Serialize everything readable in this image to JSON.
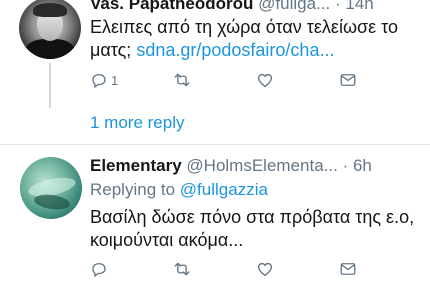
{
  "tweets": [
    {
      "display_name": "Vas. Papatheodorou",
      "handle": "@fullga...",
      "separator": "·",
      "time": "14h",
      "text": "Ελειπες από τη χώρα όταν τελείωσε το ματς;",
      "link": "sdna.gr/podosfairo/cha...",
      "reply_count": "1",
      "avatar_icon": "profile-photo-man-bw"
    },
    {
      "display_name": "Elementary",
      "handle": "@HolmsElementa...",
      "separator": "·",
      "time": "6h",
      "replying_prefix": "Replying to",
      "replying_to": "@fullgazzia",
      "text": "Βασίλη δώσε πόνο στα πρόβατα της ε.ο, κοιμούνται ακόμα...",
      "avatar_icon": "profile-photo-underwater-green"
    }
  ],
  "more_replies_label": "1 more reply",
  "action_icons": [
    "reply-icon",
    "retweet-icon",
    "like-icon",
    "message-icon"
  ],
  "colors": {
    "link": "#1b95e0",
    "secondary_text": "#657786",
    "primary_text": "#14171a",
    "divider": "#e1e8ed"
  }
}
